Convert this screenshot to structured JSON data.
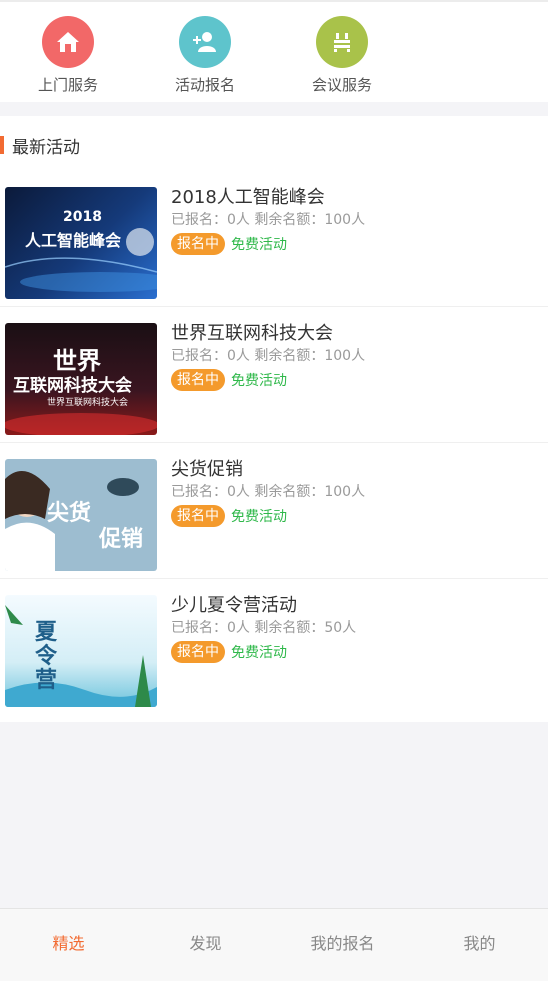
{
  "services": [
    {
      "label": "上门服务",
      "icon": "home-icon",
      "color": "#f26868"
    },
    {
      "label": "活动报名",
      "icon": "add-user-icon",
      "color": "#5ec4cc"
    },
    {
      "label": "会议服务",
      "icon": "meeting-icon",
      "color": "#a9c24a"
    }
  ],
  "section": {
    "title": "最新活动"
  },
  "activities": [
    {
      "title": "2018人工智能峰会",
      "meta": "已报名：0人 剩余名额：100人",
      "status": "报名中",
      "tag": "免费活动",
      "image_text": [
        "2018",
        "人工智能峰会"
      ]
    },
    {
      "title": "世界互联网科技大会",
      "meta": "已报名：0人 剩余名额：100人",
      "status": "报名中",
      "tag": "免费活动",
      "image_text": [
        "世界",
        "互联网科技大会",
        "世界互联网科技大会"
      ]
    },
    {
      "title": "尖货促销",
      "meta": "已报名：0人 剩余名额：100人",
      "status": "报名中",
      "tag": "免费活动",
      "image_text": [
        "尖货",
        "促销"
      ]
    },
    {
      "title": "少儿夏令营活动",
      "meta": "已报名：0人 剩余名额：50人",
      "status": "报名中",
      "tag": "免费活动",
      "image_text": [
        "夏令营"
      ]
    }
  ],
  "tabs": [
    {
      "label": "精选",
      "active": true
    },
    {
      "label": "发现",
      "active": false
    },
    {
      "label": "我的报名",
      "active": false
    },
    {
      "label": "我的",
      "active": false
    }
  ],
  "colors": {
    "accent": "#f26b32",
    "status": "#f49a2c",
    "free": "#2fb84a"
  }
}
